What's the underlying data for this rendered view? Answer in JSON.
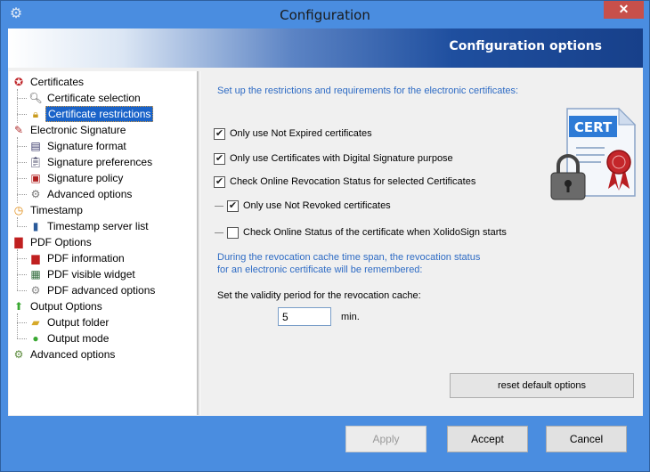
{
  "window": {
    "title": "Configuration",
    "close_label": "✕"
  },
  "banner": {
    "title": "Configuration options"
  },
  "tree": {
    "items": [
      {
        "label": "Certificates",
        "icon": "ribbon-icon"
      },
      {
        "label": "Certificate selection",
        "icon": "magnifier-icon"
      },
      {
        "label": "Certificate restrictions",
        "icon": "padlock-icon",
        "selected": true
      },
      {
        "label": "Electronic Signature",
        "icon": "pen-icon"
      },
      {
        "label": "Signature format",
        "icon": "document-icon"
      },
      {
        "label": "Signature preferences",
        "icon": "clipboard-icon"
      },
      {
        "label": "Signature policy",
        "icon": "policy-icon"
      },
      {
        "label": "Advanced options",
        "icon": "gears-icon"
      },
      {
        "label": "Timestamp",
        "icon": "clock-icon"
      },
      {
        "label": "Timestamp server list",
        "icon": "server-icon"
      },
      {
        "label": "PDF Options",
        "icon": "pdf-icon"
      },
      {
        "label": "PDF information",
        "icon": "pdf-small-icon"
      },
      {
        "label": "PDF visible widget",
        "icon": "widget-icon"
      },
      {
        "label": "PDF advanced options",
        "icon": "gear-icon"
      },
      {
        "label": "Output Options",
        "icon": "up-arrow-icon"
      },
      {
        "label": "Output folder",
        "icon": "folder-icon"
      },
      {
        "label": "Output mode",
        "icon": "mode-icon"
      },
      {
        "label": "Advanced options",
        "icon": "gears-icon"
      }
    ]
  },
  "panel": {
    "intro": "Set up the restrictions and requirements for the electronic certificates:",
    "checks": [
      {
        "label": "Only use Not Expired certificates",
        "checked": true
      },
      {
        "label": "Only use Certificates with Digital Signature purpose",
        "checked": true
      },
      {
        "label": "Check Online Revocation Status for selected Certificates",
        "checked": true
      },
      {
        "label": "Only use Not Revoked certificates",
        "checked": true
      },
      {
        "label": "Check Online Status of the certificate when XolidoSign starts",
        "checked": false
      }
    ],
    "note_line1": "During the revocation cache time span, the revocation status",
    "note_line2": "for an electronic certificate will be remembered:",
    "validity_label": "Set the validity period for the revocation cache:",
    "validity_value": "5",
    "validity_unit": "min.",
    "reset_label": "reset default options",
    "cert_badge": "CERT"
  },
  "footer": {
    "apply_label": "Apply",
    "accept_label": "Accept",
    "cancel_label": "Cancel"
  }
}
